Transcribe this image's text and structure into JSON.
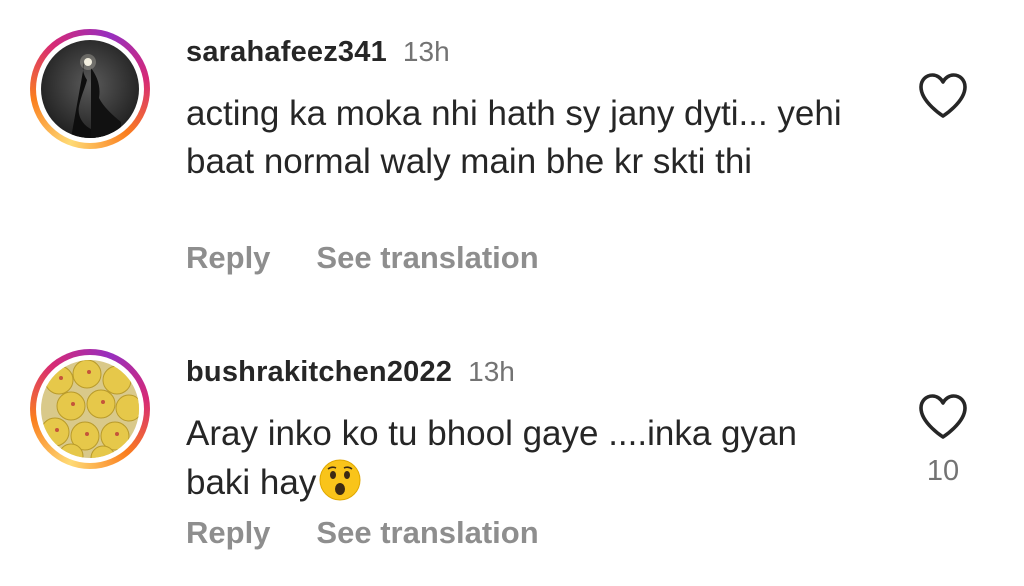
{
  "comments": [
    {
      "username": "sarahafeez341",
      "time": "13h",
      "text": "acting ka moka nhi hath sy jany dyti... yehi baat normal waly main bhe kr skti thi",
      "reply_label": "Reply",
      "translate_label": "See translation",
      "avatar_icon": "person-silhouette-avatar",
      "like_icon": "heart-icon",
      "like_count": null
    },
    {
      "username": "bushrakitchen2022",
      "time": "13h",
      "text": "Aray inko ko tu bhool gaye ....inka gyan baki hay",
      "emoji": "astonished-face-emoji",
      "reply_label": "Reply",
      "translate_label": "See translation",
      "avatar_icon": "sweets-plate-avatar",
      "like_icon": "heart-icon",
      "like_count": "10"
    }
  ],
  "colors": {
    "text": "#262626",
    "muted": "#737373",
    "action": "#8e8e8e",
    "ring_gradient": [
      "#feda75",
      "#fa7e1e",
      "#d62976",
      "#962fbf"
    ]
  }
}
